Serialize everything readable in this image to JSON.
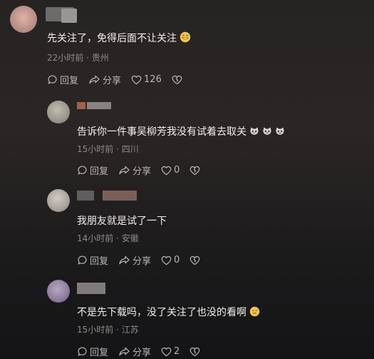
{
  "comments": [
    {
      "text": "先关注了，免得后面不让关注",
      "emoji": "grinning-sweat-face",
      "time": "22小时前",
      "location": "贵州",
      "reply_label": "回复",
      "share_label": "分享",
      "likes": "126"
    },
    {
      "text": "告诉你一件事吴柳芳我没有试着去取关",
      "emoji": "crying-cat-face",
      "time": "15小时前",
      "location": "四川",
      "reply_label": "回复",
      "share_label": "分享",
      "likes": "0"
    },
    {
      "text": "我朋友就是试了一下",
      "time": "14小时前",
      "location": "安徽",
      "reply_label": "回复",
      "share_label": "分享",
      "likes": "0"
    },
    {
      "text": "不是先下载吗，没了关注了也没的看啊",
      "emoji": "sweat-face",
      "time": "15小时前",
      "location": "江苏",
      "reply_label": "回复",
      "share_label": "分享",
      "likes": "2"
    }
  ],
  "separator": "·",
  "colors": {
    "background": "#262323",
    "text": "#f2efec",
    "meta": "#8e8a88",
    "action": "#b9b5b2"
  }
}
